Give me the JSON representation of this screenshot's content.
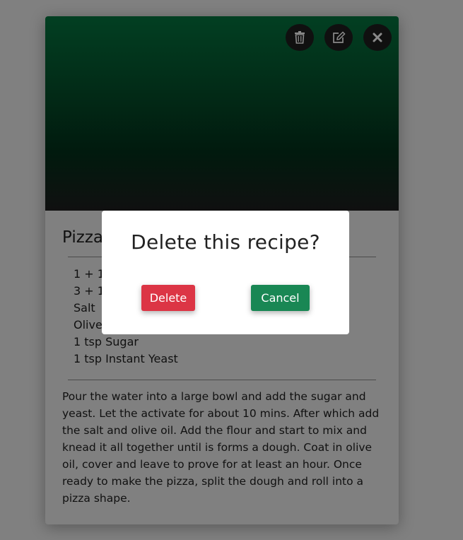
{
  "card": {
    "title": "Pizza",
    "ingredients": [
      "1 + 1/4",
      "3 + 1/",
      "Salt",
      "Olive",
      "1 tsp Sugar",
      "1 tsp Instant Yeast"
    ],
    "method": "Pour the water into a large bowl and add the sugar and yeast. Let the activate for about 10 mins. After which add the salt and olive oil. Add the flour and start to mix and knead it all together until is forms a dough. Coat in olive oil, cover and leave to prove for at least an hour. Once ready to make the pizza, split the dough and roll into a pizza shape.",
    "icons": [
      "trash-icon",
      "edit-icon",
      "close-icon"
    ]
  },
  "modal": {
    "title": "Delete this recipe?",
    "delete_label": "Delete",
    "cancel_label": "Cancel"
  },
  "colors": {
    "delete": "#dc3545",
    "cancel": "#198754",
    "hero_top": "#023f22",
    "overlay": "#808080"
  }
}
